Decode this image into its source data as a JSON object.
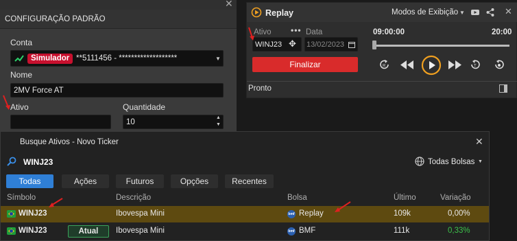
{
  "config": {
    "title": "CONFIGURAÇÃO PADRÃO",
    "conta_label": "Conta",
    "sim_badge": "Simulador",
    "account_value": "**5111456 - *******************",
    "nome_label": "Nome",
    "nome_value": "2MV Force AT",
    "ativo_label": "Ativo",
    "ativo_value": "",
    "quantidade_label": "Quantidade",
    "quantidade_value": "10"
  },
  "replay": {
    "title": "Replay",
    "mode_label": "Modos de Exibição",
    "ativo_label": "Ativo",
    "ativo_value": "WINJ23",
    "data_label": "Data",
    "data_value": "13/02/2023",
    "finalizar_label": "Finalizar",
    "time_start": "09:00:00",
    "time_end": "20:00",
    "status": "Pronto",
    "accent_color": "#f0a020",
    "finalizar_color": "#d92b2b"
  },
  "search": {
    "title": "Busque Ativos - Novo Ticker",
    "query": "WINJ23",
    "exchange_filter": "Todas Bolsas",
    "tabs": [
      "Todas",
      "Ações",
      "Futuros",
      "Opções",
      "Recentes"
    ],
    "columns": {
      "simbolo": "Símbolo",
      "descricao": "Descrição",
      "bolsa": "Bolsa",
      "ultimo": "Último",
      "variacao": "Variação"
    },
    "rows": [
      {
        "simbolo": "WINJ23",
        "badge": "",
        "descricao": "Ibovespa Mini",
        "bolsa": "Replay",
        "ultimo": "109k",
        "variacao": "0,00%"
      },
      {
        "simbolo": "WINJ23",
        "badge": "Atual",
        "descricao": "Ibovespa Mini",
        "bolsa": "BMF",
        "ultimo": "111k",
        "variacao": "0,33%"
      }
    ],
    "bolsa_icon_text": "bmf",
    "selected_row_color": "#5e4a10",
    "positive_color": "#3cc24a"
  }
}
